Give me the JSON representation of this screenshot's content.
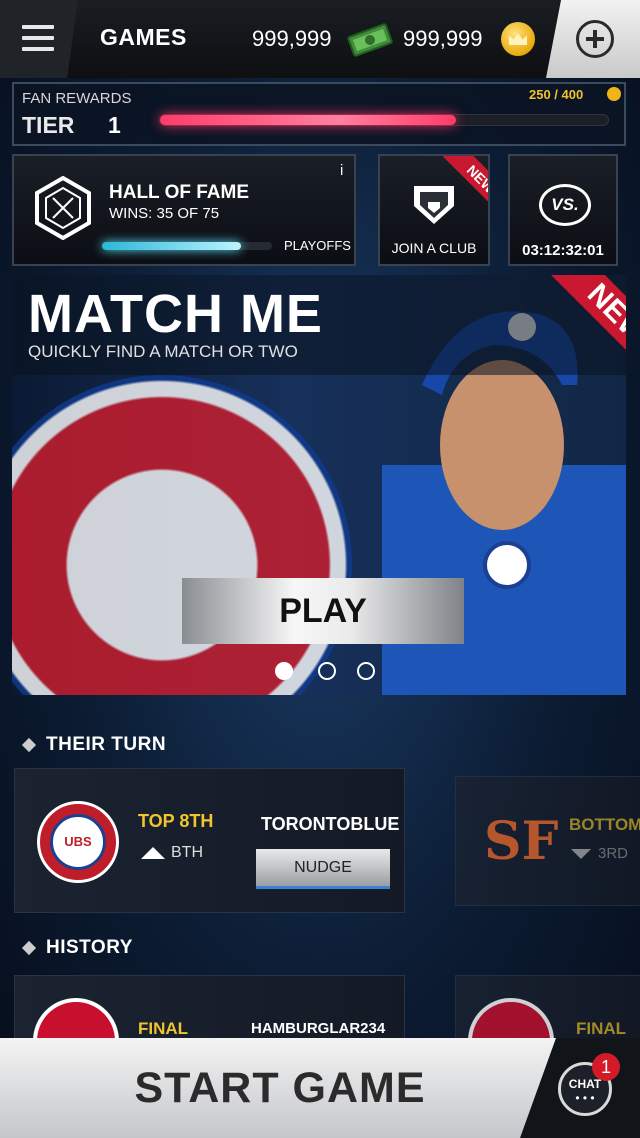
{
  "header": {
    "title": "GAMES",
    "cash": "999,999",
    "coins": "999,999",
    "menu_icon": "hamburger-icon",
    "add_icon": "plus-circle-icon"
  },
  "fan_rewards": {
    "label": "FAN REWARDS",
    "tier_label": "TIER",
    "tier_value": "1",
    "progress_text": "250 / 400",
    "progress_fraction": 0.66
  },
  "hall_of_fame": {
    "title": "HALL OF FAME",
    "wins": "WINS: 35 OF 75",
    "info": "i",
    "next_label": "PLAYOFFS",
    "progress_fraction": 0.82
  },
  "club": {
    "label": "JOIN A CLUB",
    "ribbon": "NEW"
  },
  "versus": {
    "icon_text": "VS.",
    "timer": "03:12:32:01"
  },
  "hero": {
    "title": "MATCH ME",
    "subtitle": "QUICKLY FIND A MATCH OR TWO",
    "ribbon": "NEW",
    "play_label": "PLAY",
    "page_index": 1,
    "page_count": 3
  },
  "their_turn": {
    "heading": "THEIR TURN",
    "games": [
      {
        "inning": "TOP 8TH",
        "sub": "BTH",
        "opponent": "TORONTOBLUE",
        "action": "NUDGE",
        "team_logo": "UBS"
      },
      {
        "inning": "BOTTOM",
        "sub": "3RD",
        "team_logo": "SF"
      }
    ]
  },
  "history": {
    "heading": "HISTORY",
    "games": [
      {
        "result": "FINAL",
        "opponent": "HAMBURGLAR234"
      },
      {
        "result": "FINAL"
      }
    ]
  },
  "footer": {
    "start_label": "START GAME",
    "chat_label": "CHAT",
    "chat_dots": "• • •",
    "chat_badge": "1"
  },
  "colors": {
    "accent_gold": "#f0c530",
    "fan_bar": "#ff3b6b",
    "hof_bar": "#5fe3ff",
    "ribbon_red": "#c9182f"
  }
}
